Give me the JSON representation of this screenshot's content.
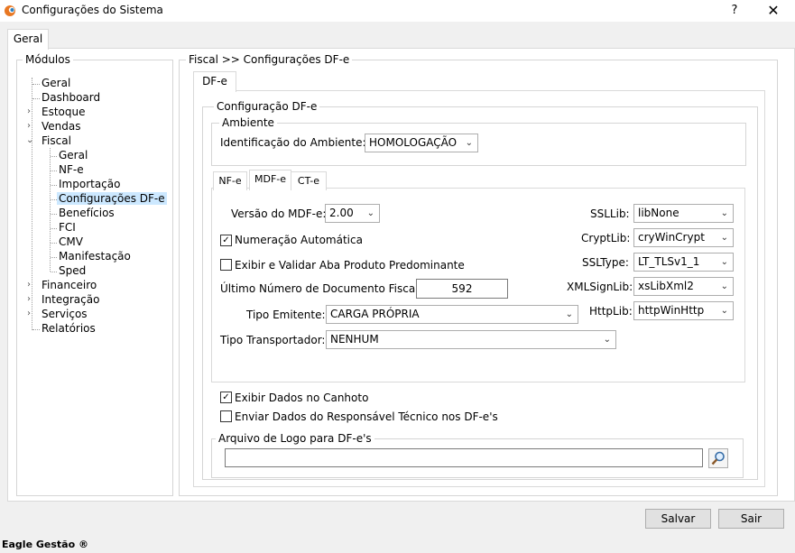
{
  "window": {
    "title": "Configurações do Sistema",
    "help_label": "?",
    "close_label": "✕"
  },
  "outer_tab": {
    "label": "Geral"
  },
  "modules": {
    "legend": "Módulos",
    "items": [
      {
        "label": "Geral"
      },
      {
        "label": "Dashboard"
      },
      {
        "label": "Estoque"
      },
      {
        "label": "Vendas"
      },
      {
        "label": "Fiscal"
      },
      {
        "label": "Geral"
      },
      {
        "label": "NF-e"
      },
      {
        "label": "Importação"
      },
      {
        "label": "Configurações DF-e"
      },
      {
        "label": "Benefícios"
      },
      {
        "label": "FCI"
      },
      {
        "label": "CMV"
      },
      {
        "label": "Manifestação"
      },
      {
        "label": "Sped"
      },
      {
        "label": "Financeiro"
      },
      {
        "label": "Integração"
      },
      {
        "label": "Serviços"
      },
      {
        "label": "Relatórios"
      }
    ]
  },
  "breadcrumb": "Fiscal >> Configurações DF-e",
  "dfe_tab": {
    "label": "DF-e"
  },
  "config": {
    "legend": "Configuração DF-e",
    "ambiente": {
      "legend": "Ambiente",
      "label": "Identificação do Ambiente:",
      "value": "HOMOLOGAÇÃO"
    },
    "tabs": [
      {
        "label": "NF-e"
      },
      {
        "label": "MDF-e"
      },
      {
        "label": "CT-e"
      }
    ],
    "mdfe": {
      "versao_label": "Versão do MDF-e:",
      "versao_value": "2.00",
      "numeracao_label": "Numeração Automática",
      "exibir_label": "Exibir e Validar Aba Produto Predominante",
      "ultimo_label": "Último Número de Documento Fiscal:",
      "ultimo_value": "592",
      "tipo_emitente_label": "Tipo Emitente:",
      "tipo_emitente_value": "CARGA PRÓPRIA",
      "tipo_transportador_label": "Tipo Transportador:",
      "tipo_transportador_value": "NENHUM",
      "ssllib_label": "SSLLib:",
      "ssllib_value": "libNone",
      "cryptlib_label": "CryptLib:",
      "cryptlib_value": "cryWinCrypt",
      "ssltype_label": "SSLType:",
      "ssltype_value": "LT_TLSv1_1",
      "xmlsignlib_label": "XMLSignLib:",
      "xmlsignlib_value": "xsLibXml2",
      "httplib_label": "HttpLib:",
      "httplib_value": "httpWinHttp"
    },
    "exibir_canhoto_label": "Exibir Dados no Canhoto",
    "enviar_resp_label": "Enviar Dados do Responsável Técnico nos DF-e's",
    "logo": {
      "legend": "Arquivo de Logo para DF-e's",
      "value": ""
    }
  },
  "buttons": {
    "salvar": "Salvar",
    "sair": "Sair"
  },
  "status": "Eagle Gestão ®"
}
